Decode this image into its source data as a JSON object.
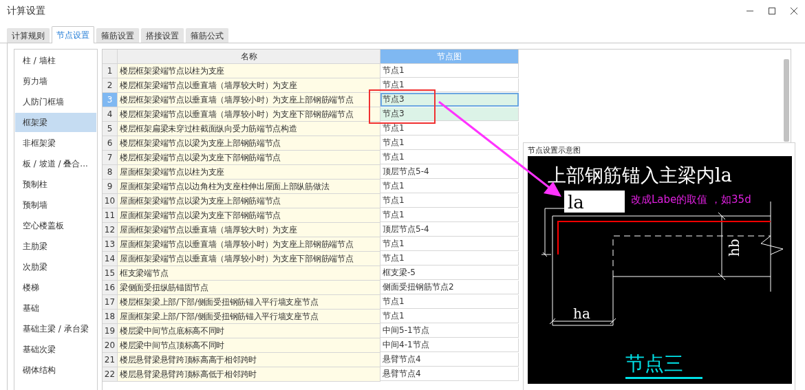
{
  "window": {
    "title": "计算设置"
  },
  "tabs": [
    {
      "label": "计算规则",
      "selected": false
    },
    {
      "label": "节点设置",
      "selected": true
    },
    {
      "label": "箍筋设置",
      "selected": false
    },
    {
      "label": "搭接设置",
      "selected": false
    },
    {
      "label": "箍筋公式",
      "selected": false
    }
  ],
  "sidebar": {
    "items": [
      {
        "label": "柱 / 墙柱",
        "selected": false
      },
      {
        "label": "剪力墙",
        "selected": false
      },
      {
        "label": "人防门框墙",
        "selected": false
      },
      {
        "label": "框架梁",
        "selected": true
      },
      {
        "label": "非框架梁",
        "selected": false
      },
      {
        "label": "板 / 坡道 / 叠合...",
        "selected": false
      },
      {
        "label": "预制柱",
        "selected": false
      },
      {
        "label": "预制墙",
        "selected": false
      },
      {
        "label": "空心楼盖板",
        "selected": false
      },
      {
        "label": "主肋梁",
        "selected": false
      },
      {
        "label": "次肋梁",
        "selected": false
      },
      {
        "label": "楼梯",
        "selected": false
      },
      {
        "label": "基础",
        "selected": false
      },
      {
        "label": "基础主梁 / 承台梁",
        "selected": false
      },
      {
        "label": "基础次梁",
        "selected": false
      },
      {
        "label": "砌体结构",
        "selected": false
      }
    ]
  },
  "table": {
    "columns": [
      {
        "label": "名称",
        "selected": false
      },
      {
        "label": "节点图",
        "selected": true
      }
    ],
    "rows": [
      {
        "num": "1",
        "name": "楼层框架梁端节点以柱为支座",
        "node": "节点1",
        "selected": false,
        "highlighted": false
      },
      {
        "num": "2",
        "name": "楼层框架梁端节点以垂直墙（墙厚较大时）为支座",
        "node": "节点1",
        "selected": false,
        "highlighted": false
      },
      {
        "num": "3",
        "name": "楼层框架梁端节点以垂直墙（墙厚较小时）为支座上部钢筋端节点",
        "node": "节点3",
        "selected": true,
        "highlighted": true
      },
      {
        "num": "4",
        "name": "楼层框架梁端节点以垂直墙（墙厚较小时）为支座下部钢筋端节点",
        "node": "节点3",
        "selected": false,
        "highlighted": true
      },
      {
        "num": "5",
        "name": "楼层框架扁梁未穿过柱截面纵向受力筋端节点构造",
        "node": "节点1",
        "selected": false,
        "highlighted": false
      },
      {
        "num": "6",
        "name": "楼层框架梁端节点以梁为支座上部钢筋端节点",
        "node": "节点1",
        "selected": false,
        "highlighted": false
      },
      {
        "num": "7",
        "name": "楼层框架梁端节点以梁为支座下部钢筋端节点",
        "node": "节点1",
        "selected": false,
        "highlighted": false
      },
      {
        "num": "8",
        "name": "屋面框架梁端节点以柱为支座",
        "node": "顶层节点5-4",
        "selected": false,
        "highlighted": false
      },
      {
        "num": "9",
        "name": "屋面框架梁端节点以边角柱为支座柱伸出屋面上部纵筋做法",
        "node": "节点1",
        "selected": false,
        "highlighted": false
      },
      {
        "num": "10",
        "name": "屋面框架梁端节点以梁为支座上部钢筋端节点",
        "node": "节点1",
        "selected": false,
        "highlighted": false
      },
      {
        "num": "11",
        "name": "屋面框架梁端节点以梁为支座下部钢筋端节点",
        "node": "节点1",
        "selected": false,
        "highlighted": false
      },
      {
        "num": "12",
        "name": "屋面框架梁端节点以垂直墙（墙厚较大时）为支座",
        "node": "顶层节点5-4",
        "selected": false,
        "highlighted": false
      },
      {
        "num": "13",
        "name": "屋面框架梁端节点以垂直墙（墙厚较小时）为支座上部钢筋端节点",
        "node": "节点1",
        "selected": false,
        "highlighted": false
      },
      {
        "num": "14",
        "name": "屋面框架梁端节点以垂直墙（墙厚较小时）为支座下部钢筋端节点",
        "node": "节点1",
        "selected": false,
        "highlighted": false
      },
      {
        "num": "15",
        "name": "框支梁端节点",
        "node": "框支梁-5",
        "selected": false,
        "highlighted": false
      },
      {
        "num": "16",
        "name": "梁侧面受扭纵筋锚固节点",
        "node": "侧面受扭钢筋节点2",
        "selected": false,
        "highlighted": false
      },
      {
        "num": "17",
        "name": "楼层框架梁上部/下部/侧面受扭钢筋锚入平行墙支座节点",
        "node": "节点1",
        "selected": false,
        "highlighted": false
      },
      {
        "num": "18",
        "name": "屋面框架梁上部/下部/侧面受扭钢筋锚入平行墙支座节点",
        "node": "节点1",
        "selected": false,
        "highlighted": false
      },
      {
        "num": "19",
        "name": "楼层梁中间节点底标高不同时",
        "node": "中间5-1节点",
        "selected": false,
        "highlighted": false
      },
      {
        "num": "20",
        "name": "楼层梁中间节点顶标高不同时",
        "node": "中间4-1节点",
        "selected": false,
        "highlighted": false
      },
      {
        "num": "21",
        "name": "楼层悬臂梁悬臂跨顶标高高于相邻跨时",
        "node": "悬臂节点4",
        "selected": false,
        "highlighted": false
      },
      {
        "num": "22",
        "name": "楼层悬臂梁悬臂跨顶标高低于相邻跨时",
        "node": "悬臂节点4",
        "selected": false,
        "highlighted": false
      }
    ]
  },
  "preview": {
    "title": "节点设置示意图",
    "diagram": {
      "heading": "上部钢筋锚入主梁内la",
      "anchor_label": "la",
      "width_label": "ha",
      "height_label": "hb",
      "caption": "节点三"
    }
  },
  "annotation": {
    "note": "改成Labe的取值 ，如35d"
  }
}
